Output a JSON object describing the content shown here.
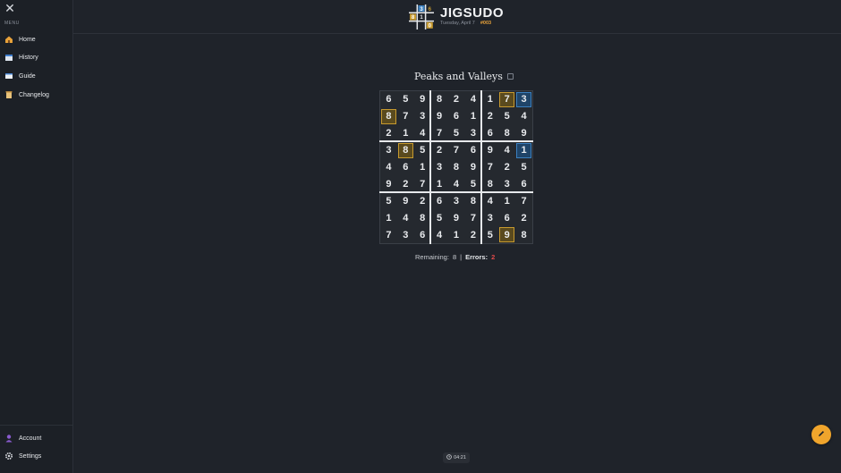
{
  "sidebar": {
    "menu_label": "MENU",
    "items": [
      {
        "label": "Home",
        "icon": "home-icon"
      },
      {
        "label": "History",
        "icon": "calendar-icon"
      },
      {
        "label": "Guide",
        "icon": "book-icon"
      },
      {
        "label": "Changelog",
        "icon": "scroll-icon"
      }
    ],
    "bottom_items": [
      {
        "label": "Account",
        "icon": "user-icon"
      },
      {
        "label": "Settings",
        "icon": "gear-icon"
      }
    ]
  },
  "header": {
    "title": "JIGSUDO",
    "date": "Tuesday, April 7",
    "number": "#003",
    "logo_digits": [
      "3",
      "1",
      "6",
      "8",
      "0"
    ]
  },
  "puzzle": {
    "title": "Peaks and Valleys",
    "grid": [
      [
        "6",
        "5",
        "9",
        "8",
        "2",
        "4",
        "1",
        "7",
        "3"
      ],
      [
        "8",
        "7",
        "3",
        "9",
        "6",
        "1",
        "2",
        "5",
        "4"
      ],
      [
        "2",
        "1",
        "4",
        "7",
        "5",
        "3",
        "6",
        "8",
        "9"
      ],
      [
        "3",
        "8",
        "5",
        "2",
        "7",
        "6",
        "9",
        "4",
        "1"
      ],
      [
        "4",
        "6",
        "1",
        "3",
        "8",
        "9",
        "7",
        "2",
        "5"
      ],
      [
        "9",
        "2",
        "7",
        "1",
        "4",
        "5",
        "8",
        "3",
        "6"
      ],
      [
        "5",
        "9",
        "2",
        "6",
        "3",
        "8",
        "4",
        "1",
        "7"
      ],
      [
        "1",
        "4",
        "8",
        "5",
        "9",
        "7",
        "3",
        "6",
        "2"
      ],
      [
        "7",
        "3",
        "6",
        "4",
        "1",
        "2",
        "5",
        "9",
        "8"
      ]
    ],
    "highlights": {
      "gold": [
        [
          0,
          7
        ],
        [
          1,
          0
        ],
        [
          3,
          1
        ],
        [
          8,
          7
        ]
      ],
      "blue": [
        [
          0,
          8
        ],
        [
          3,
          8
        ]
      ]
    }
  },
  "status": {
    "remaining_label": "Remaining:",
    "remaining_value": "8",
    "separator": "|",
    "errors_label": "Errors:",
    "errors_value": "2"
  },
  "timer": {
    "value": "04:21"
  },
  "colors": {
    "accent": "#f0a52c",
    "gold": "#c79a2e",
    "blue": "#3a7fbf",
    "error": "#e04a4a"
  }
}
